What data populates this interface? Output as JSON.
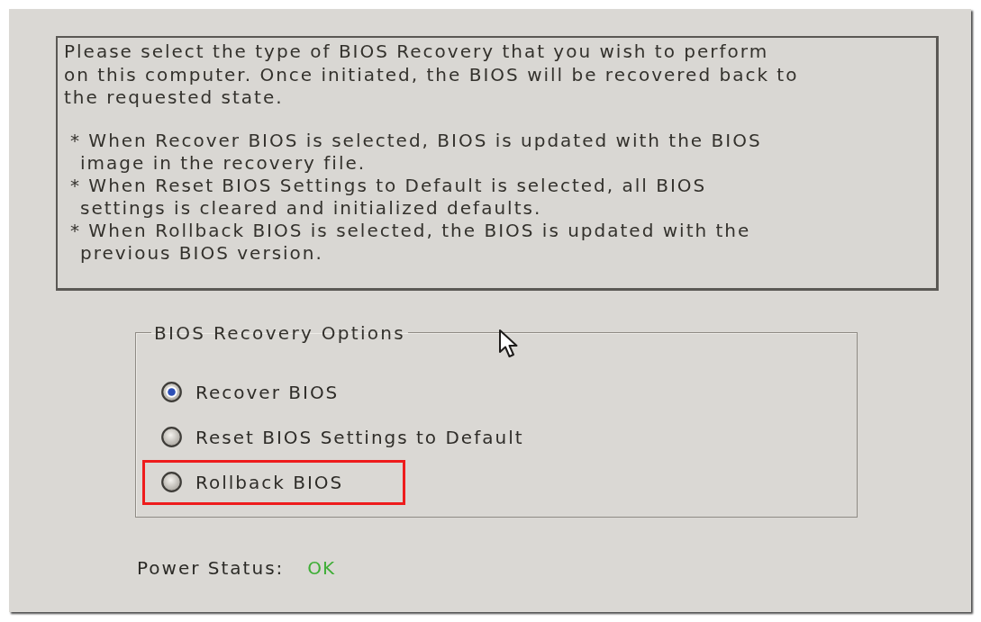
{
  "description": {
    "intro_lines": [
      "Please select the type of BIOS Recovery that you wish to perform",
      "on this computer. Once initiated, the BIOS will be recovered back to",
      "the requested state."
    ],
    "notes": [
      {
        "lines": [
          "* When Recover BIOS is selected, BIOS is updated with the BIOS",
          "image in the recovery file."
        ]
      },
      {
        "lines": [
          "* When Reset BIOS Settings to Default is selected, all BIOS",
          "settings is cleared and initialized defaults."
        ]
      },
      {
        "lines": [
          "* When Rollback BIOS is selected, the BIOS is updated with the",
          "previous BIOS version."
        ]
      }
    ]
  },
  "recovery_options": {
    "title": "BIOS Recovery Options",
    "options": [
      {
        "label": "Recover BIOS",
        "selected": true,
        "highlighted": false
      },
      {
        "label": "Reset BIOS Settings to Default",
        "selected": false,
        "highlighted": false
      },
      {
        "label": "Rollback BIOS",
        "selected": false,
        "highlighted": true
      }
    ]
  },
  "power_status": {
    "label": "Power Status:",
    "value": "OK"
  }
}
